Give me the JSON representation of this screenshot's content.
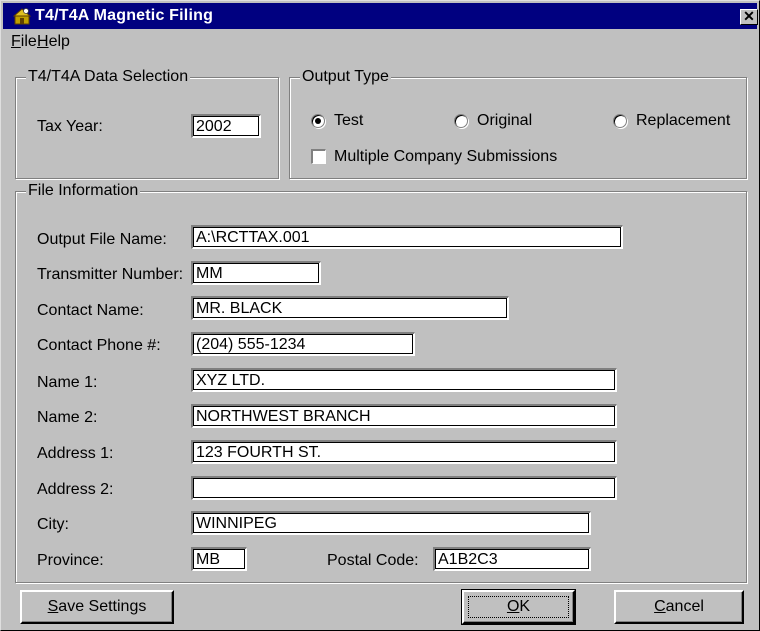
{
  "window": {
    "title": "T4/T4A Magnetic Filing",
    "close_glyph": "✕",
    "icon": "app-icon"
  },
  "menu": {
    "items": [
      {
        "label": "File",
        "mnemonic": "F",
        "rest": "ile"
      },
      {
        "label": "Help",
        "mnemonic": "H",
        "rest": "elp"
      }
    ]
  },
  "data_selection": {
    "legend": "T4/T4A Data Selection",
    "tax_year_label": "Tax Year:",
    "tax_year_value": "2002"
  },
  "output_type": {
    "legend": "Output Type",
    "options": [
      {
        "label": "Test",
        "selected": true
      },
      {
        "label": "Original",
        "selected": false
      },
      {
        "label": "Replacement",
        "selected": false
      }
    ],
    "multiple_label": "Multiple Company Submissions",
    "multiple_checked": false
  },
  "file_info": {
    "legend": "File Information",
    "output_file_name": {
      "label": "Output File Name:",
      "value": "A:\\RCTTAX.001"
    },
    "transmitter_number": {
      "label": "Transmitter Number:",
      "value": "MM"
    },
    "contact_name": {
      "label": "Contact Name:",
      "value": "MR. BLACK"
    },
    "contact_phone": {
      "label": "Contact Phone #:",
      "value": "(204) 555-1234"
    },
    "name1": {
      "label": "Name 1:",
      "value": "XYZ LTD."
    },
    "name2": {
      "label": "Name 2:",
      "value": "NORTHWEST BRANCH"
    },
    "address1": {
      "label": "Address 1:",
      "value": "123 FOURTH ST."
    },
    "address2": {
      "label": "Address 2:",
      "value": ""
    },
    "city": {
      "label": "City:",
      "value": "WINNIPEG"
    },
    "province": {
      "label": "Province:",
      "value": "MB"
    },
    "postal_code": {
      "label": "Postal Code:",
      "value": "A1B2C3"
    }
  },
  "buttons": {
    "save_settings": {
      "label": "Save Settings",
      "mnemonic": "S",
      "rest": "ave Settings"
    },
    "ok": {
      "label": "OK",
      "mnemonic": "O",
      "rest": "K"
    },
    "cancel": {
      "label": "Cancel",
      "mnemonic": "C",
      "rest": "ancel"
    }
  },
  "colors": {
    "titlebar": "#000080",
    "face": "#c0c0c0"
  }
}
